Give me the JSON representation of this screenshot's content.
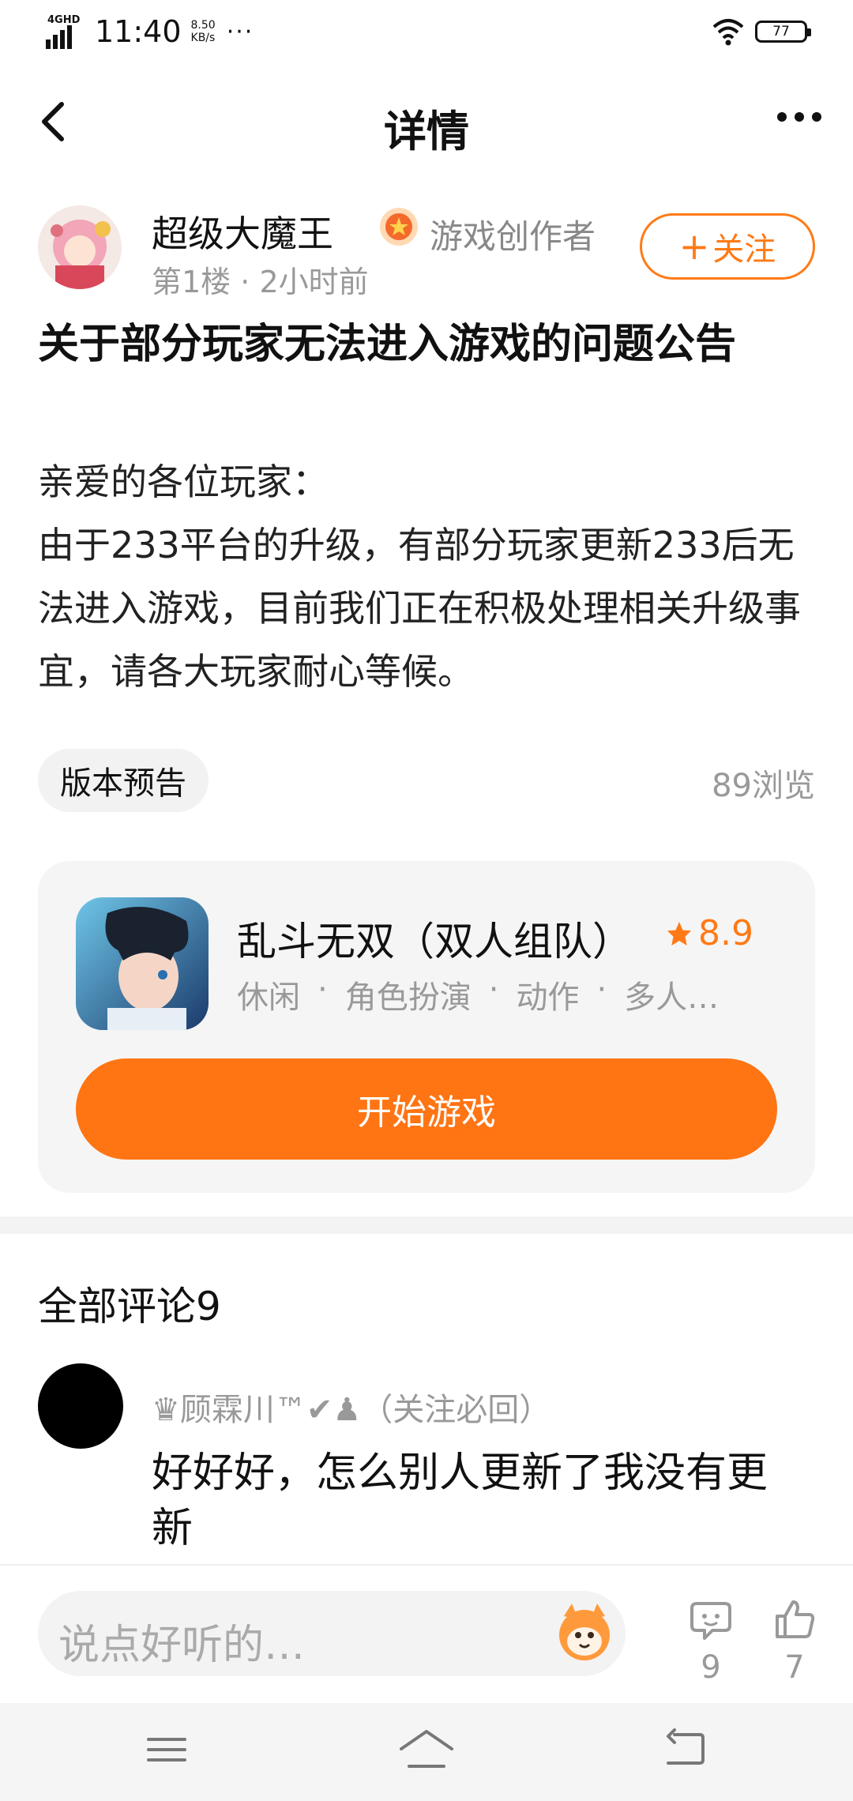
{
  "status_bar": {
    "network": "4GHD",
    "time": "11:40",
    "speed_value": "8.50",
    "speed_unit": "KB/s",
    "more": "···",
    "battery": "77"
  },
  "nav": {
    "title": "详情",
    "back_icon": "chevron-left-icon",
    "more_icon": "more-dots-icon"
  },
  "author": {
    "name": "超级大魔王",
    "badge": "游戏创作者",
    "floor": "第1楼",
    "separator": "·",
    "time": "2小时前",
    "follow_label": "关注",
    "follow_plus": "+"
  },
  "post": {
    "title": "关于部分玩家无法进入游戏的问题公告",
    "greeting": "亲爱的各位玩家：",
    "body": "由于233平台的升级，有部分玩家更新233后无法进入游戏，目前我们正在积极处理相关升级事宜，请各大玩家耐心等候。",
    "tag": "版本预告",
    "views": "89浏览"
  },
  "game": {
    "name": "乱斗无双（双人组队）",
    "rating": "8.9",
    "tags": [
      "休闲",
      "·",
      "角色扮演",
      "·",
      "动作",
      "·",
      "多人…"
    ],
    "play_label": "开始游戏"
  },
  "comments": {
    "title": "全部评论9",
    "items": [
      {
        "user": "♛顾霖川™✔♟（关注必回）",
        "text": "好好好，怎么别人更新了我没有更新"
      }
    ]
  },
  "input_bar": {
    "placeholder": "说点好听的…",
    "comment_count": "9",
    "like_count": "7"
  },
  "colors": {
    "accent": "#ff7413",
    "muted": "#999999",
    "card_bg": "#f5f5f5"
  }
}
